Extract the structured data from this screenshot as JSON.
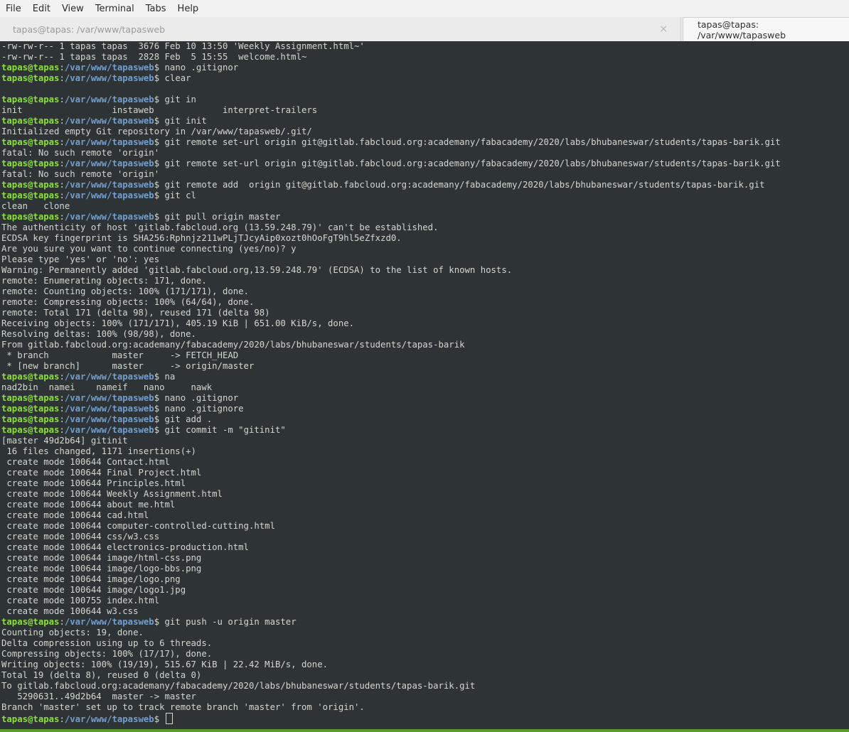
{
  "menu": [
    "File",
    "Edit",
    "View",
    "Terminal",
    "Tabs",
    "Help"
  ],
  "tabs": [
    {
      "title": "tapas@tapas: /var/www/tapasweb",
      "active": false,
      "close": "×"
    },
    {
      "title": "tapas@tapas: /var/www/tapasweb",
      "active": true
    }
  ],
  "prompt": {
    "user": "tapas@tapas",
    "sep": ":",
    "path": "/var/www/tapasweb",
    "dollar": "$"
  },
  "colors": {
    "bg": "#2e3436",
    "fg": "#d3d7cf",
    "user": "#8ae234",
    "path": "#729fcf"
  },
  "lines": [
    {
      "t": "-rw-rw-r-- 1 tapas tapas  3676 Feb 10 13:50 'Weekly Assignment.html~'"
    },
    {
      "t": "-rw-rw-r-- 1 tapas tapas  2828 Feb  5 15:55  welcome.html~"
    },
    {
      "p": true,
      "t": " nano .gitignor"
    },
    {
      "p": true,
      "t": " clear"
    },
    {
      "t": ""
    },
    {
      "p": true,
      "t": " git in"
    },
    {
      "t": "init                 instaweb             interpret-trailers"
    },
    {
      "p": true,
      "t": " git init"
    },
    {
      "t": "Initialized empty Git repository in /var/www/tapasweb/.git/"
    },
    {
      "p": true,
      "t": " git remote set-url origin git@gitlab.fabcloud.org:academany/fabacademy/2020/labs/bhubaneswar/students/tapas-barik.git"
    },
    {
      "t": "fatal: No such remote 'origin'"
    },
    {
      "p": true,
      "t": " git remote set-url origin git@gitlab.fabcloud.org:academany/fabacademy/2020/labs/bhubaneswar/students/tapas-barik.git"
    },
    {
      "t": "fatal: No such remote 'origin'"
    },
    {
      "p": true,
      "t": " git remote add  origin git@gitlab.fabcloud.org:academany/fabacademy/2020/labs/bhubaneswar/students/tapas-barik.git"
    },
    {
      "p": true,
      "t": " git cl"
    },
    {
      "t": "clean   clone"
    },
    {
      "p": true,
      "t": " git pull origin master"
    },
    {
      "t": "The authenticity of host 'gitlab.fabcloud.org (13.59.248.79)' can't be established."
    },
    {
      "t": "ECDSA key fingerprint is SHA256:Rphnjz211wPLjTJcyAip0xozt0hOoFgT9hl5eZfxzd0."
    },
    {
      "t": "Are you sure you want to continue connecting (yes/no)? y"
    },
    {
      "t": "Please type 'yes' or 'no': yes"
    },
    {
      "t": "Warning: Permanently added 'gitlab.fabcloud.org,13.59.248.79' (ECDSA) to the list of known hosts."
    },
    {
      "t": "remote: Enumerating objects: 171, done."
    },
    {
      "t": "remote: Counting objects: 100% (171/171), done."
    },
    {
      "t": "remote: Compressing objects: 100% (64/64), done."
    },
    {
      "t": "remote: Total 171 (delta 98), reused 171 (delta 98)"
    },
    {
      "t": "Receiving objects: 100% (171/171), 405.19 KiB | 651.00 KiB/s, done."
    },
    {
      "t": "Resolving deltas: 100% (98/98), done."
    },
    {
      "t": "From gitlab.fabcloud.org:academany/fabacademy/2020/labs/bhubaneswar/students/tapas-barik"
    },
    {
      "t": " * branch            master     -> FETCH_HEAD"
    },
    {
      "t": " * [new branch]      master     -> origin/master"
    },
    {
      "p": true,
      "t": " na"
    },
    {
      "t": "nad2bin  namei    nameif   nano     nawk"
    },
    {
      "p": true,
      "t": " nano .gitignor"
    },
    {
      "p": true,
      "t": " nano .gitignore"
    },
    {
      "p": true,
      "t": " git add ."
    },
    {
      "p": true,
      "t": " git commit -m \"gitinit\""
    },
    {
      "t": "[master 49d2b64] gitinit"
    },
    {
      "t": " 16 files changed, 1171 insertions(+)"
    },
    {
      "t": " create mode 100644 Contact.html"
    },
    {
      "t": " create mode 100644 Final Project.html"
    },
    {
      "t": " create mode 100644 Principles.html"
    },
    {
      "t": " create mode 100644 Weekly Assignment.html"
    },
    {
      "t": " create mode 100644 about me.html"
    },
    {
      "t": " create mode 100644 cad.html"
    },
    {
      "t": " create mode 100644 computer-controlled-cutting.html"
    },
    {
      "t": " create mode 100644 css/w3.css"
    },
    {
      "t": " create mode 100644 electronics-production.html"
    },
    {
      "t": " create mode 100644 image/html-css.png"
    },
    {
      "t": " create mode 100644 image/logo-bbs.png"
    },
    {
      "t": " create mode 100644 image/logo.png"
    },
    {
      "t": " create mode 100644 image/logo1.jpg"
    },
    {
      "t": " create mode 100755 index.html"
    },
    {
      "t": " create mode 100644 w3.css"
    },
    {
      "p": true,
      "t": " git push -u origin master"
    },
    {
      "t": "Counting objects: 19, done."
    },
    {
      "t": "Delta compression using up to 6 threads."
    },
    {
      "t": "Compressing objects: 100% (17/17), done."
    },
    {
      "t": "Writing objects: 100% (19/19), 515.67 KiB | 22.42 MiB/s, done."
    },
    {
      "t": "Total 19 (delta 8), reused 0 (delta 0)"
    },
    {
      "t": "To gitlab.fabcloud.org:academany/fabacademy/2020/labs/bhubaneswar/students/tapas-barik.git"
    },
    {
      "t": "   5290631..49d2b64  master -> master"
    },
    {
      "t": "Branch 'master' set up to track remote branch 'master' from 'origin'."
    },
    {
      "p": true,
      "t": " ",
      "cursor": true
    }
  ]
}
